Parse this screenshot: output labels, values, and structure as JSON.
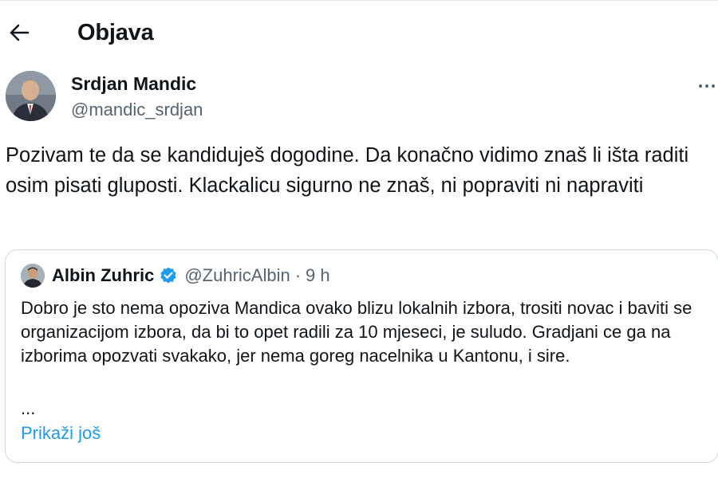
{
  "header": {
    "title": "Objava",
    "back_icon": "arrow-left-icon"
  },
  "post": {
    "author_name": "Srdjan Mandic",
    "author_handle": "@mandic_srdjan",
    "more_icon": "more-horizontal-icon",
    "text": "Pozivam te da se kandiduješ dogodine. Da konačno vidimo znaš li išta raditi osim pisati gluposti. Klackalicu sigurno ne znaš, ni popraviti ni napraviti"
  },
  "quote": {
    "author_name": "Albin Zuhric",
    "verified_icon": "verified-badge-icon",
    "author_handle": "@ZuhricAlbin",
    "separator": "·",
    "time": "9 h",
    "text": "Dobro je sto nema opoziva Mandica ovako blizu lokalnih izbora, trositi novac i baviti se organizacijom izbora, da bi to opet radili za 10 mjeseci, je suludo. Gradjani ce ga na izborima opozvati svakako, jer nema goreg nacelnika u Kantonu, i sire.",
    "ellipsis": "...",
    "show_more": "Prikaži još"
  },
  "colors": {
    "text_primary": "#0f1419",
    "text_secondary": "#536471",
    "link": "#1d9bf0",
    "border": "#cfd9de"
  }
}
